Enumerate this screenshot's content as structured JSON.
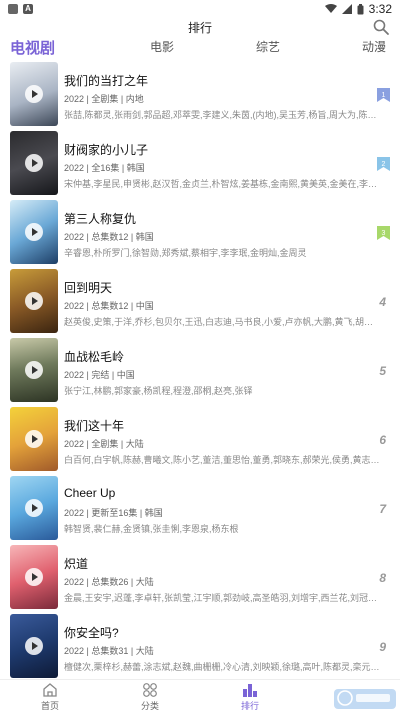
{
  "status_bar": {
    "time": "3:32"
  },
  "header": {
    "title": "排行"
  },
  "tabs": [
    {
      "label": "电视剧",
      "active": true
    },
    {
      "label": "电影",
      "active": false
    },
    {
      "label": "综艺",
      "active": false
    },
    {
      "label": "动漫",
      "active": false
    }
  ],
  "items": [
    {
      "title": "我们的当打之年",
      "meta": "2022 | 全剧集 | 内地",
      "cast": "张喆,陈都灵,张雨剑,郭品超,邓萃雯,李建义,朱茵,(内地),吴玉芳,杨旨,周大为,陈昊蓝",
      "rank": "1",
      "badge_color": "#8aa0e0"
    },
    {
      "title": "财阀家的小儿子",
      "meta": "2022 | 全16集 | 韩国",
      "cast": "宋仲基,李星民,申贤彬,赵汉哲,金贞兰,朴智炫,姜基栋,金南熙,黄美英,金美在,李吉宇",
      "rank": "2",
      "badge_color": "#8ac4e8"
    },
    {
      "title": "第三人称复仇",
      "meta": "2022 | 总集数12 | 韩国",
      "cast": "辛睿恩,朴所罗门,徐智勋,郑秀斌,蔡相宇,李李珉,金明灿,金周灵",
      "rank": "3",
      "badge_color": "#a8d86a"
    },
    {
      "title": "回到明天",
      "meta": "2022 | 总集数12 | 中国",
      "cast": "赵英俊,史策,于洋,乔杉,包贝尔,王迅,白志迪,马书良,小爱,卢亦帆,大鹏,黄飞,胡夏,白客,崔志佳",
      "rank": "4"
    },
    {
      "title": "血战松毛岭",
      "meta": "2022 | 完结 | 中国",
      "cast": "张宁江,林鹏,郭家豪,杨凯程,程澄,邵桐,赵亮,张铎",
      "rank": "5"
    },
    {
      "title": "我们这十年",
      "meta": "2022 | 全剧集 | 大陆",
      "cast": "白百何,白宇帆,陈赫,曹曦文,陈小艺,董洁,董思怡,董勇,郭晓东,郝荣光,侯勇,黄志忠,焦俊艳,靳东",
      "rank": "6"
    },
    {
      "title": "Cheer Up",
      "meta": "2022 | 更新至16集 | 韩国",
      "cast": "韩智贤,裴仁赫,金贤镇,张圭悧,李恩泉,杨东根",
      "rank": "7"
    },
    {
      "title": "炽道",
      "meta": "2022 | 总集数26 | 大陆",
      "cast": "金晨,王安宇,迟蓬,李卓轩,张凯莹,江宇顺,郭劲岐,高圣皓羽,刘增宇,西兰花,刘冠成,徐浩儿",
      "rank": "8"
    },
    {
      "title": "你安全吗?",
      "meta": "2022 | 总集数31 | 大陆",
      "cast": "檀健次,栗梓杉,赫蕾,涂志斌,赵魏,曲栅栅,冷心清,刘映颖,徐璐,高叶,陈都灵,栾元晖,梁大棣,王志文",
      "rank": "9"
    }
  ],
  "bottom_nav": [
    {
      "label": "首页",
      "active": false
    },
    {
      "label": "分类",
      "active": false
    },
    {
      "label": "排行",
      "active": true
    }
  ],
  "colors": {
    "accent": "#7a63d6"
  }
}
